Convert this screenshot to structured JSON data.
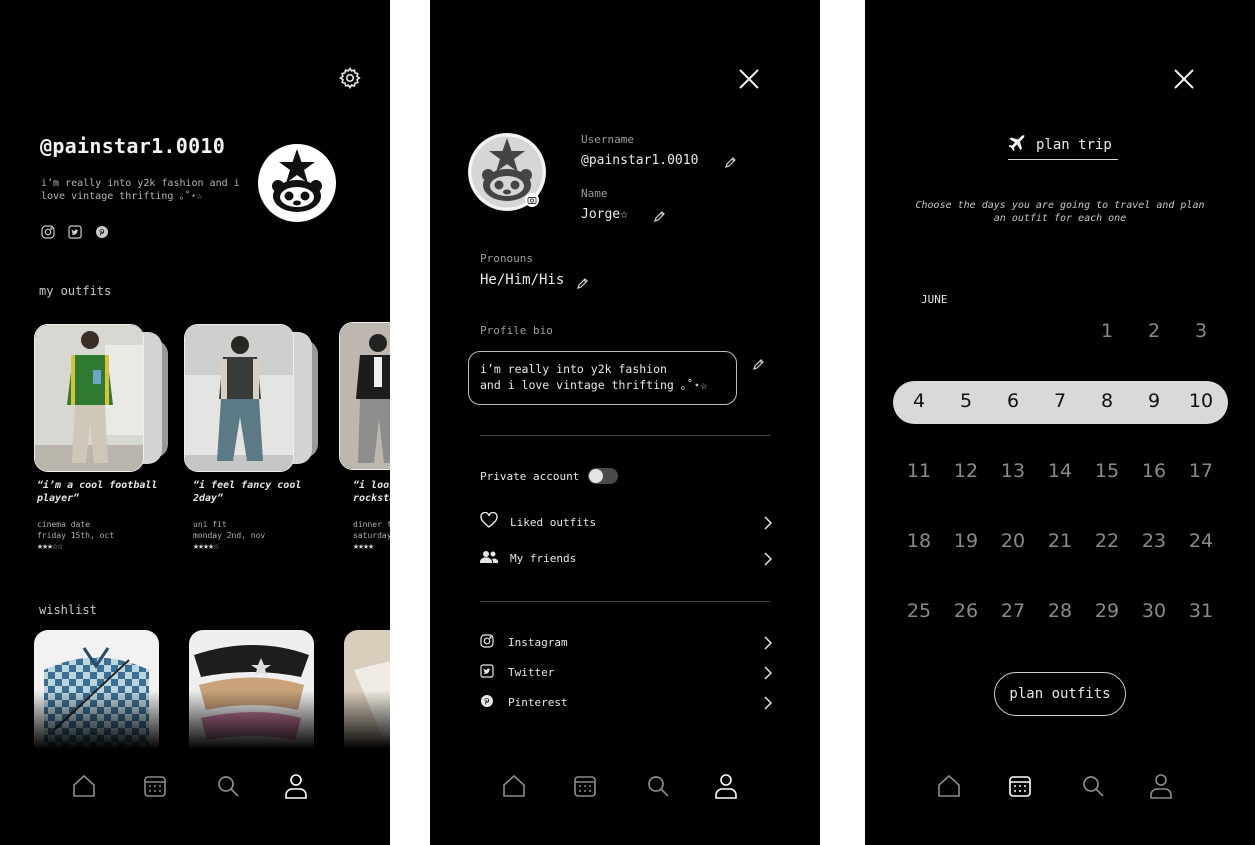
{
  "profile": {
    "handle": "@painstar1.0010",
    "bio": "i’m really into y2k fashion and i love vintage thrifting ｡˚⋆☆",
    "socials": [
      "instagram-icon",
      "twitter-icon",
      "pinterest-icon"
    ],
    "my_outfits_title": "my outfits",
    "outfits": [
      {
        "caption": "“i’m a cool football player”",
        "event": "cinema date",
        "date": "friday 15th, oct",
        "stars": "★★★☆☆",
        "rating": 3
      },
      {
        "caption": "“i feel fancy cool 2day”",
        "event": "uni fit",
        "date": "monday 2nd, nov",
        "stars": "★★★★☆",
        "rating": 4
      },
      {
        "caption": "“i look like a rockstar",
        "event": "dinner f",
        "date": "saturday",
        "stars": "★★★★",
        "rating": 4
      }
    ],
    "wishlist_title": "wishlist"
  },
  "edit": {
    "username_label": "Username",
    "username": "@painstar1.0010",
    "name_label": "Name",
    "name": "Jorge☆",
    "pronouns_label": "Pronouns",
    "pronouns": "He/Him/His",
    "bio_label": "Profile bio",
    "bio_line1": "i’m really into y2k fashion",
    "bio_line2": "and i love vintage thrifting ｡˚⋆☆",
    "private_label": "Private account",
    "private_on": false,
    "liked_label": "Liked outfits",
    "friends_label": "My friends",
    "instagram_label": "Instagram",
    "twitter_label": "Twitter",
    "pinterest_label": "Pinterest"
  },
  "trip": {
    "title": "plan trip",
    "description": "Choose the days you are going to travel and plan an outfit for each one",
    "month": "JUNE",
    "weeks": [
      [
        "",
        "",
        "",
        "",
        "1",
        "2",
        "3"
      ],
      [
        "4",
        "5",
        "6",
        "7",
        "8",
        "9",
        "10"
      ],
      [
        "11",
        "12",
        "13",
        "14",
        "15",
        "16",
        "17"
      ],
      [
        "18",
        "19",
        "20",
        "21",
        "22",
        "23",
        "24"
      ],
      [
        "25",
        "26",
        "27",
        "28",
        "29",
        "30",
        "31"
      ]
    ],
    "selected_week_index": 1,
    "button_label": "plan outfits"
  },
  "nav": {
    "items": [
      "home-icon",
      "calendar-icon",
      "search-icon",
      "profile-icon"
    ]
  },
  "colors": {
    "background": "#000000",
    "text": "#e8e8e8",
    "muted": "#9c9c9c",
    "selection": "#d9d9d9"
  }
}
